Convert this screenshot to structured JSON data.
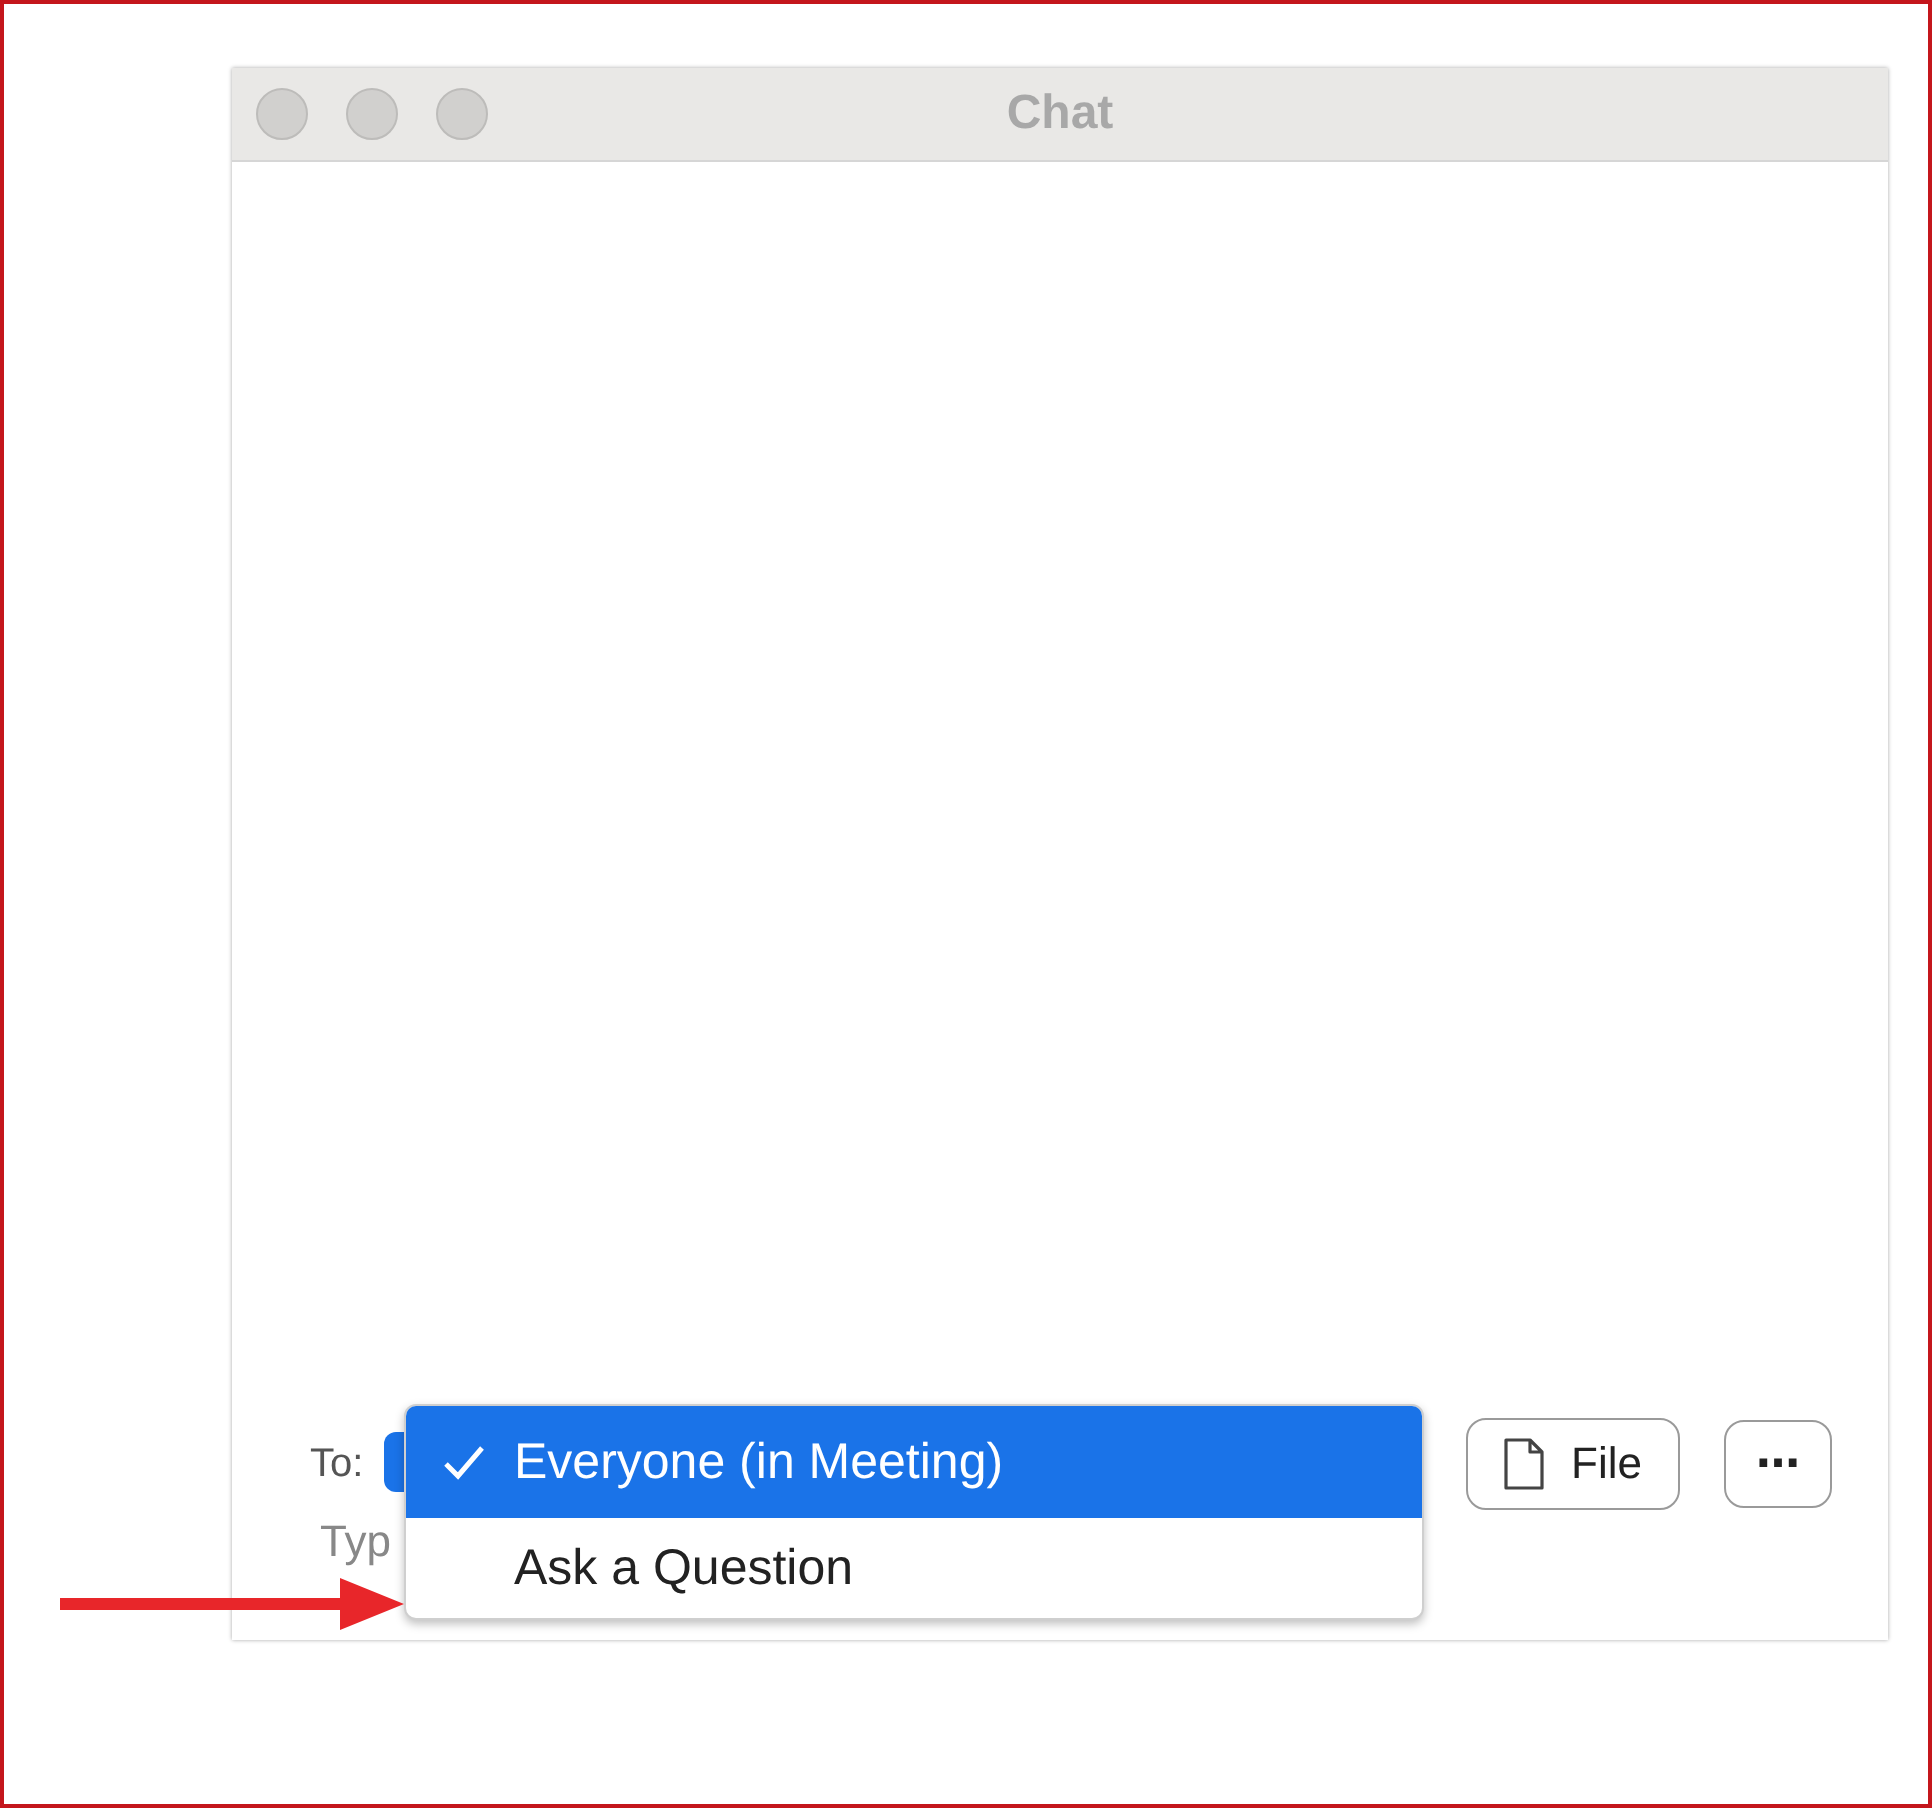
{
  "window": {
    "title": "Chat"
  },
  "composer": {
    "to_label": "To:",
    "file_button": "File",
    "more_button": "⋯",
    "message_placeholder": "Typ"
  },
  "recipient_menu": [
    {
      "label": "Everyone (in Meeting)",
      "selected": true
    },
    {
      "label": "Ask a Question",
      "selected": false
    }
  ]
}
